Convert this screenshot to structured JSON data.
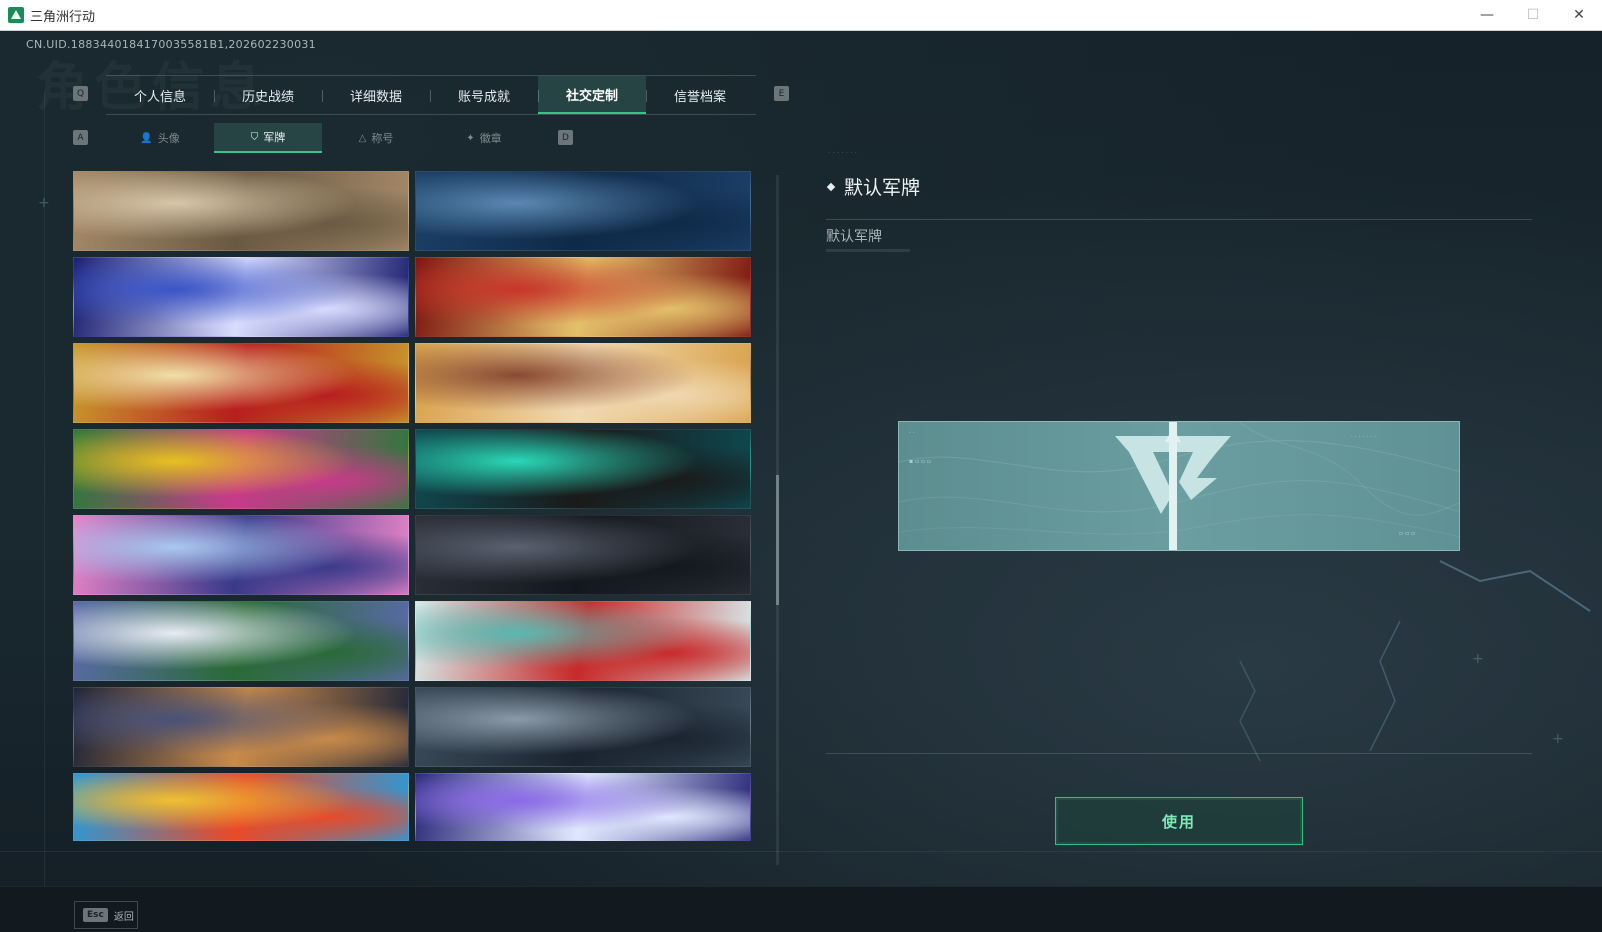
{
  "window": {
    "title": "三角洲行动",
    "controls": {
      "minimize": "—",
      "maximize": "☐",
      "close": "✕"
    }
  },
  "header": {
    "uid": "CN.UID.1883440184170035581B1,202602230031",
    "watermark": "角色信息"
  },
  "main_tabs": {
    "prev_key": "Q",
    "next_key": "E",
    "items": [
      {
        "label": "个人信息",
        "active": false
      },
      {
        "label": "历史战绩",
        "active": false
      },
      {
        "label": "详细数据",
        "active": false
      },
      {
        "label": "账号成就",
        "active": false
      },
      {
        "label": "社交定制",
        "active": true
      },
      {
        "label": "信誉档案",
        "active": false
      }
    ]
  },
  "sub_tabs": {
    "prev_key": "A",
    "next_key": "D",
    "items": [
      {
        "label": "头像",
        "icon": "person-icon",
        "glyph": "👤",
        "active": false
      },
      {
        "label": "军牌",
        "icon": "dogtag-icon",
        "glyph": "⛉",
        "active": true
      },
      {
        "label": "称号",
        "icon": "title-icon",
        "glyph": "△",
        "active": false
      },
      {
        "label": "徽章",
        "icon": "badge-icon",
        "glyph": "✦",
        "active": false
      }
    ]
  },
  "banners": [
    {
      "theme": "desert-sniper",
      "colors": [
        "#a58a68",
        "#d8c6a8",
        "#6a5a44"
      ]
    },
    {
      "theme": "naval-base",
      "colors": [
        "#1c3f66",
        "#5a88b3",
        "#0e2a48"
      ]
    },
    {
      "theme": "celestial-blue",
      "colors": [
        "#1b1e6e",
        "#3a55c8",
        "#d8dcff"
      ]
    },
    {
      "theme": "red-roses",
      "colors": [
        "#7a1410",
        "#c8362a",
        "#e4c06a"
      ]
    },
    {
      "theme": "golden-jewel",
      "colors": [
        "#c89a2c",
        "#f0e0a8",
        "#b81e1e"
      ]
    },
    {
      "theme": "chibi-party",
      "colors": [
        "#d8a24a",
        "#8a4a32",
        "#f0d8b0"
      ]
    },
    {
      "theme": "carnival-colors",
      "colors": [
        "#2a7a3a",
        "#e8c020",
        "#c83a8a"
      ]
    },
    {
      "theme": "rock-graffiti",
      "colors": [
        "#0e4a52",
        "#2ad8b8",
        "#1a1a1a"
      ]
    },
    {
      "theme": "pink-anime",
      "colors": [
        "#e884c8",
        "#a8c8f0",
        "#3a3a8a"
      ]
    },
    {
      "theme": "city-dusk-soldier",
      "colors": [
        "#2a2f38",
        "#5a6270",
        "#14181e"
      ]
    },
    {
      "theme": "christmas-tree",
      "colors": [
        "#5a6aa8",
        "#e8ecf4",
        "#2a6a38"
      ]
    },
    {
      "theme": "snowball-fight",
      "colors": [
        "#d8ecec",
        "#5ab8b0",
        "#c82a2a"
      ]
    },
    {
      "theme": "night-ops",
      "colors": [
        "#1e2438",
        "#4a5278",
        "#c88a4a"
      ]
    },
    {
      "theme": "pilot-jet",
      "colors": [
        "#3a4a58",
        "#8a9aa8",
        "#1a2430"
      ]
    },
    {
      "theme": "fries-mascots",
      "colors": [
        "#2a9ad8",
        "#f0c030",
        "#e84a2a"
      ]
    },
    {
      "theme": "lightning-lab",
      "colors": [
        "#2a2a78",
        "#8a6ae8",
        "#e0e8ff"
      ]
    }
  ],
  "detail": {
    "title": "默认军牌",
    "name": "默认军牌",
    "use_label": "使用"
  },
  "footer": {
    "esc_key": "Esc",
    "back_label": "返回"
  },
  "colors": {
    "accent": "#39c28a",
    "preview_bg": "#6a9ea0"
  }
}
